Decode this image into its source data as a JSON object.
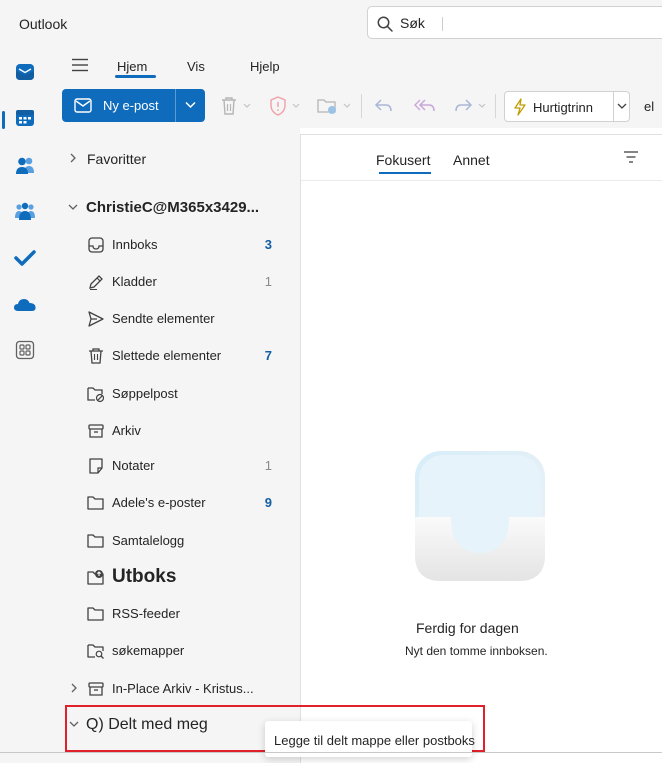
{
  "app": {
    "title": "Outlook"
  },
  "search": {
    "text": "Søk"
  },
  "rail": {
    "items": [
      {
        "icon": "mail-icon",
        "active": true
      },
      {
        "icon": "calendar-icon"
      },
      {
        "icon": "people-icon"
      },
      {
        "icon": "groups-icon"
      },
      {
        "icon": "todo-icon"
      },
      {
        "icon": "onedrive-icon"
      },
      {
        "icon": "apps-icon"
      }
    ]
  },
  "ribbon": {
    "tabs": [
      {
        "label": "Hjem",
        "selected": true
      },
      {
        "label": "Vis"
      },
      {
        "label": "Hjelp"
      }
    ],
    "new_mail_label": "Ny e-post",
    "quick_steps_label": "Hurtigtrinn",
    "overflow_text": "el"
  },
  "folders": {
    "favorites_label": "Favoritter",
    "account_label": "ChristieC@M365x3429...",
    "items": [
      {
        "label": "Innboks",
        "count": "3",
        "count_style": "bold",
        "icon": "inbox-icon"
      },
      {
        "label": "Kladder",
        "count": "1",
        "count_style": "light",
        "icon": "drafts-icon"
      },
      {
        "label": "Sendte elementer",
        "count": "",
        "icon": "sent-icon"
      },
      {
        "label": "Slettede elementer",
        "count": "7",
        "count_style": "bold",
        "icon": "trash-icon"
      },
      {
        "label": "Søppelpost",
        "count": "",
        "icon": "junk-icon"
      },
      {
        "label": "Arkiv",
        "count": "",
        "icon": "archive-icon"
      },
      {
        "label": "Notater",
        "count": "1",
        "count_style": "light",
        "icon": "notes-icon"
      },
      {
        "label": "Adele's e-poster",
        "count": "9",
        "count_style": "bold",
        "icon": "folder-icon"
      },
      {
        "label": "Samtalelogg",
        "count": "",
        "icon": "folder-icon"
      },
      {
        "label": "Utboks",
        "count": "",
        "icon": "outbox-icon"
      },
      {
        "label": "RSS-feeder",
        "count": "",
        "icon": "folder-icon"
      },
      {
        "label": "søkemapper",
        "count": "",
        "icon": "search-folder-icon"
      }
    ],
    "archive_label": "In-Place Arkiv - Kristus...",
    "shared_label": "Q) Delt med meg"
  },
  "list": {
    "tabs": [
      {
        "label": "Fokusert",
        "selected": true
      },
      {
        "label": "Annet"
      }
    ],
    "empty_title": "Ferdig for dagen",
    "empty_subtitle": "Nyt den tomme innboksen."
  },
  "tooltip": {
    "text": "Legge til delt mappe eller postboks"
  },
  "colors": {
    "accent": "#0f6cbd",
    "highlight": "#e0202a",
    "count": "#115ea3"
  }
}
